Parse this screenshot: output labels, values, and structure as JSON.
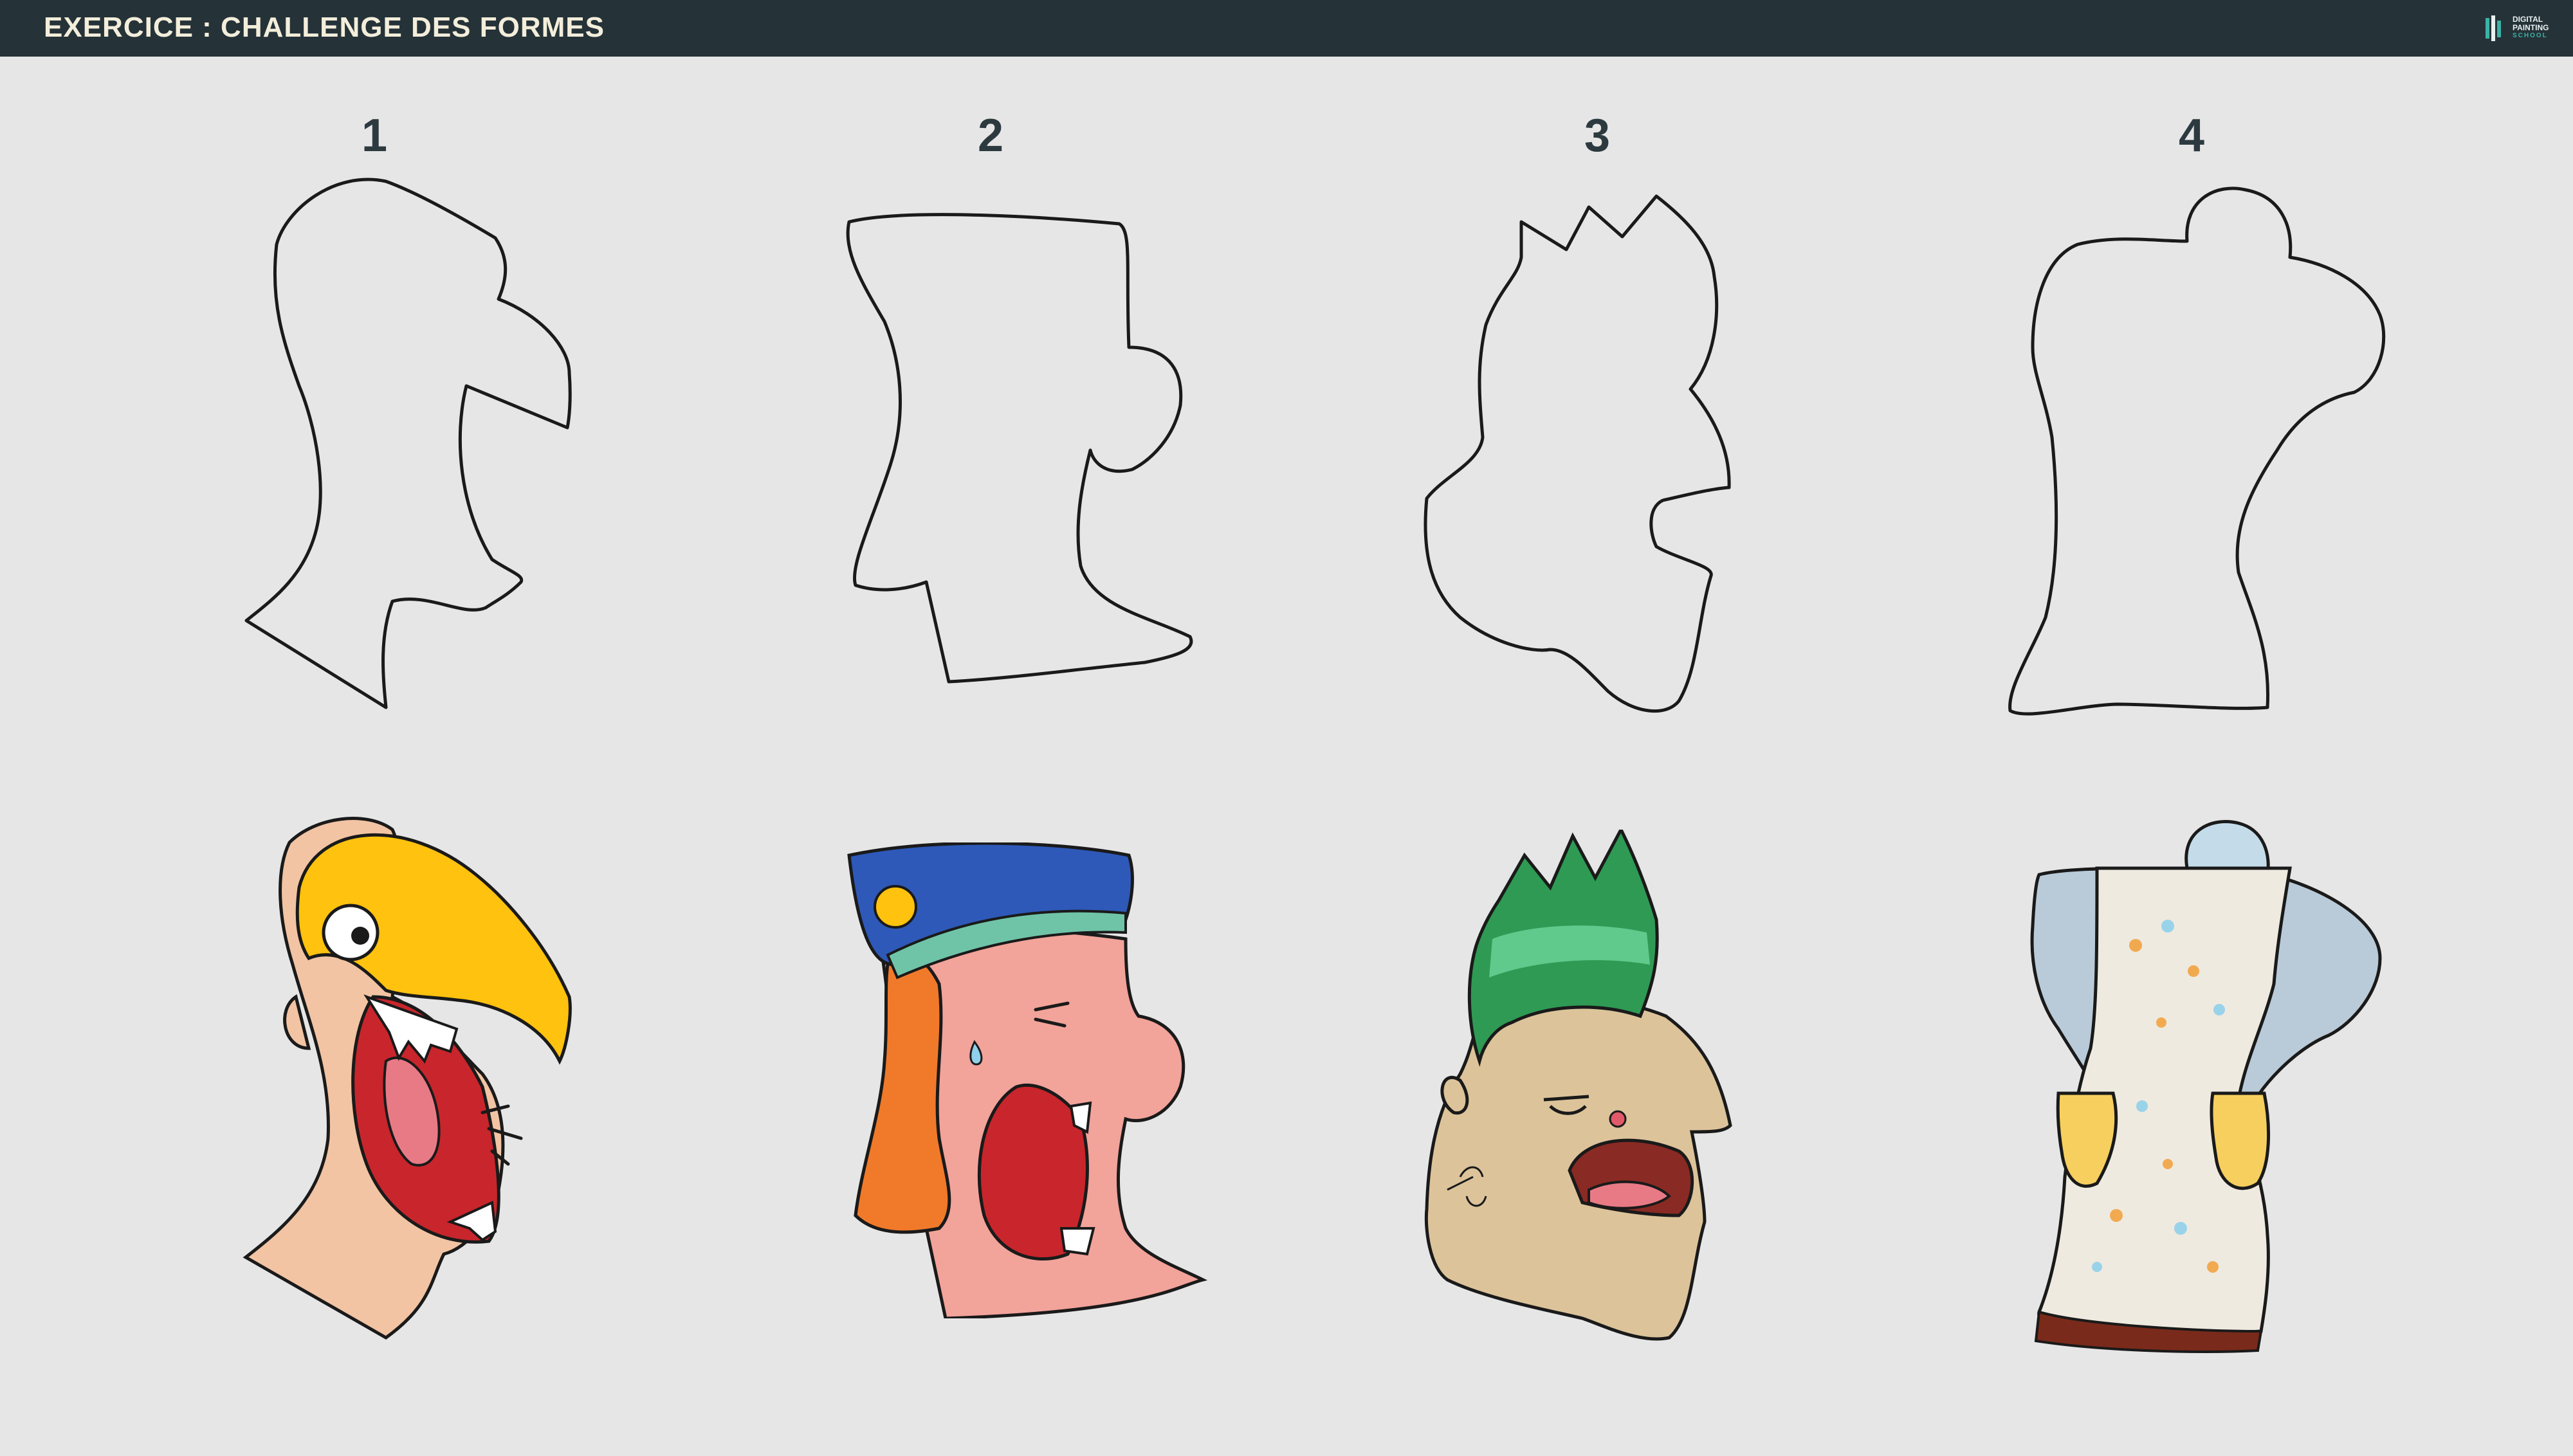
{
  "header": {
    "title": "EXERCICE : CHALLENGE DES FORMES",
    "logo": {
      "line1": "DIGITAL",
      "line2": "PAINTING",
      "line3": "SCHOOL"
    }
  },
  "exercises": [
    {
      "number": "1",
      "character": "bird-mask-man"
    },
    {
      "number": "2",
      "character": "shouting-cap-man"
    },
    {
      "number": "3",
      "character": "green-hair-punk"
    },
    {
      "number": "4",
      "character": "apron-figure"
    }
  ],
  "colors": {
    "header_bg": "#253238",
    "header_text": "#f3eedb",
    "background": "#e6e6e6",
    "outline": "#1a1a1a",
    "skin": "#f2c4a3",
    "beak": "#ffc20e",
    "cap": "#2e59b8",
    "hair_orange": "#f07a2a",
    "hair_green": "#2f9a54",
    "skin_tan": "#dcc39a",
    "sleeve": "#b9cad8",
    "apron": "#eeeae0",
    "mitt": "#f6cf5e"
  }
}
